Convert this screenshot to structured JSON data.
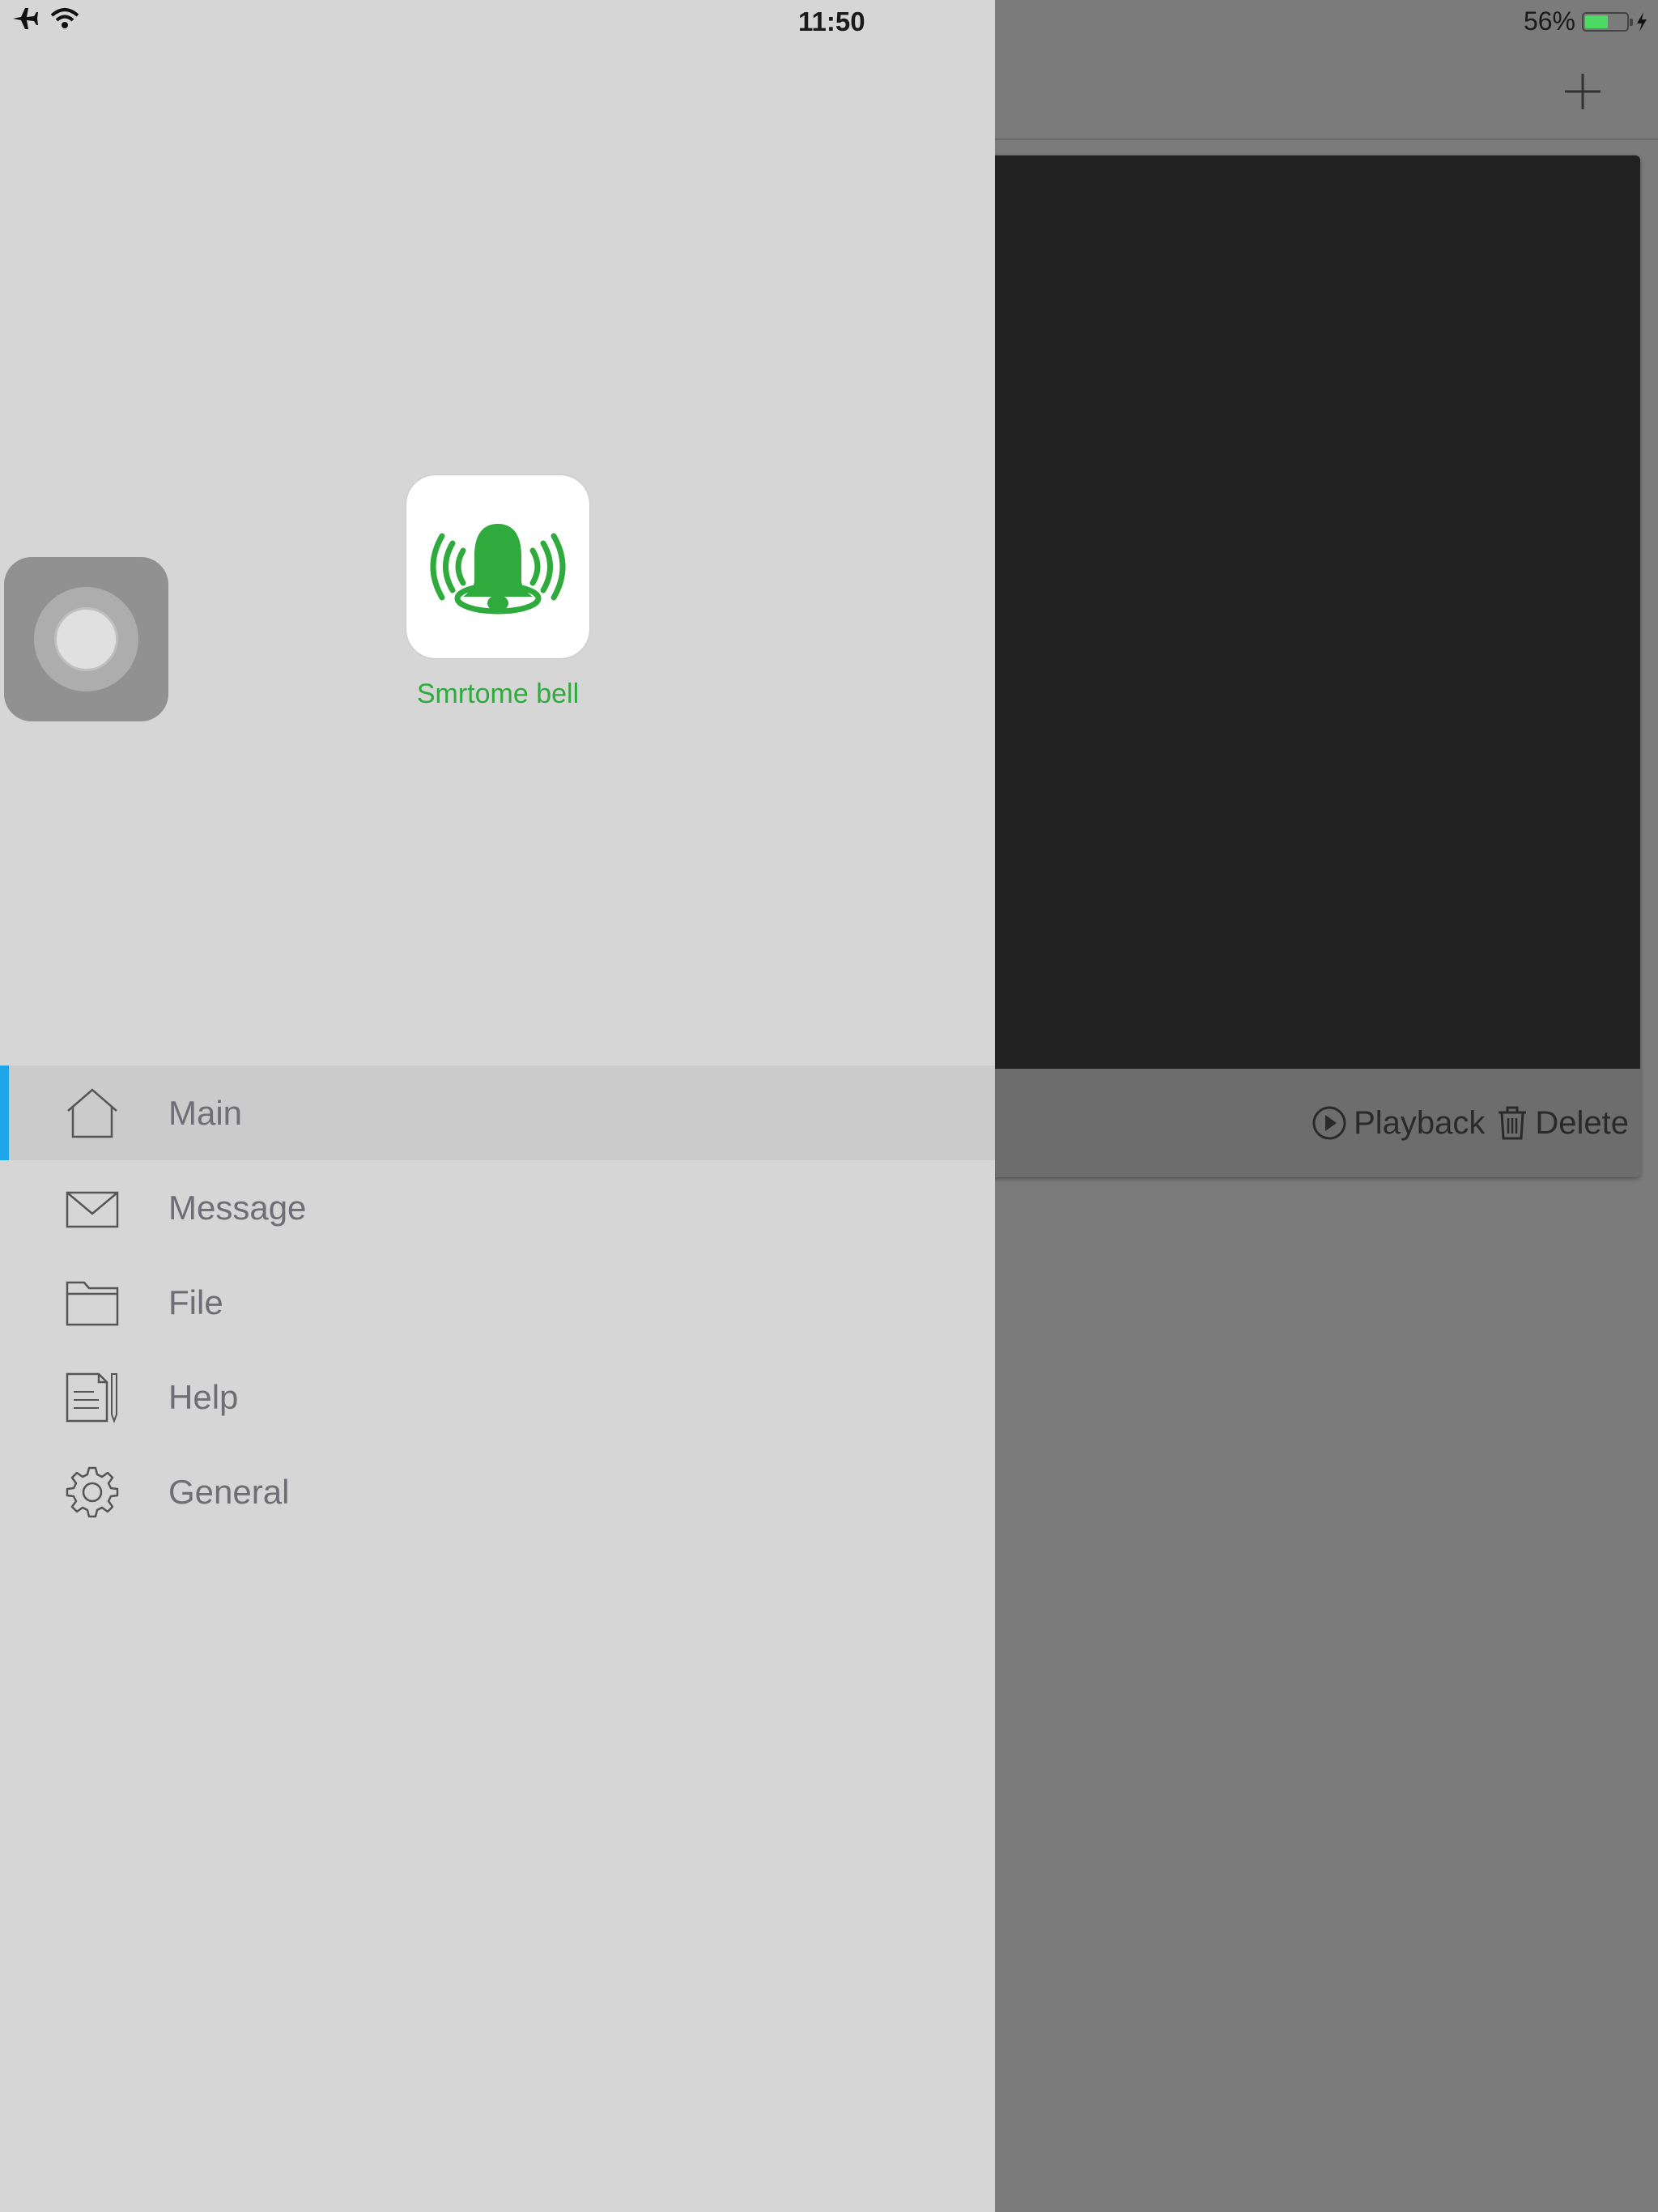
{
  "status_bar": {
    "time": "11:50",
    "battery_percent_label": "56%",
    "battery_level": 0.56,
    "airplane_icon": "airplane-icon",
    "wifi_icon": "wifi-icon",
    "charging_icon": "bolt-icon"
  },
  "main": {
    "add_icon": "plus-icon",
    "card": {
      "playback_label": "Playback",
      "delete_label": "Delete",
      "playback_icon": "play-circle-icon",
      "delete_icon": "trash-icon"
    }
  },
  "drawer": {
    "app_name": "Smrtome bell",
    "logo_icon": "bell-icon",
    "menu": [
      {
        "label": "Main",
        "icon": "home-icon",
        "active": true
      },
      {
        "label": "Message",
        "icon": "envelope-icon",
        "active": false
      },
      {
        "label": "File",
        "icon": "folder-icon",
        "active": false
      },
      {
        "label": "Help",
        "icon": "document-pencil-icon",
        "active": false
      },
      {
        "label": "General",
        "icon": "gear-icon",
        "active": false
      }
    ]
  },
  "colors": {
    "accent": "#1fa6e8",
    "brand_green": "#2faa3d",
    "drawer_bg": "#d6d6d6",
    "dimmed_bg": "#7b7b7b"
  }
}
